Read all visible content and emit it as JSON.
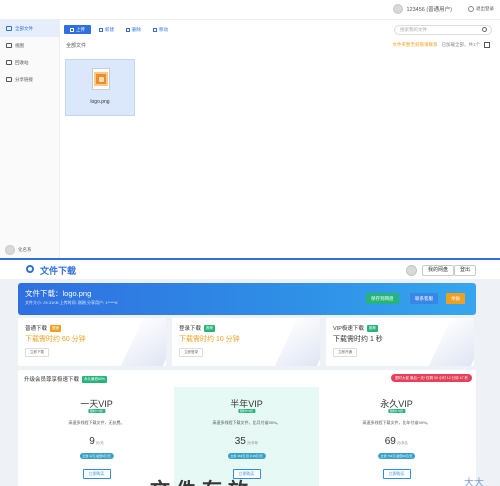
{
  "drive": {
    "user_name": "123456 (普通用户)",
    "logout_label": "退出登录",
    "sidebar": [
      {
        "label": "全部文件",
        "active": true
      },
      {
        "label": "视图",
        "active": false
      },
      {
        "label": "回收站",
        "active": false
      },
      {
        "label": "分享链接",
        "active": false
      }
    ],
    "sidebar_user": "化名系",
    "toolbar": {
      "upload": "上传",
      "new_folder": "新建",
      "delete": "删除",
      "move": "移动"
    },
    "search_placeholder": "搜索我的文件",
    "breadcrumb": "全部文件",
    "notice": "文件夹暂无权限请联系",
    "count_text": "已加载全部，共1个",
    "file": {
      "name": "logo.png"
    }
  },
  "download": {
    "header_title": "文件下载",
    "header_buttons": {
      "my_drive": "我的网盘",
      "logout": "登出"
    },
    "banner": {
      "file_title": "文件下载：logo.png",
      "meta": "文件大小: 25.31KB  上传时间: 刚刚  分享用户: 1*****6",
      "buttons": [
        {
          "label": "保存到网盘",
          "color": "#26b47a"
        },
        {
          "label": "联系客服",
          "color": "#3a86e8"
        },
        {
          "label": "举报",
          "color": "#f0a020"
        }
      ]
    },
    "modes": [
      {
        "title": "普通下载",
        "tag": "慢速",
        "tag_color": "#f0a020",
        "speed": "下载需时约 60 分钟",
        "speed_color": "#f0a020",
        "button": "立即下载"
      },
      {
        "title": "登录下载",
        "tag": "推荐",
        "tag_color": "#26b47a",
        "speed": "下载需时约 10 分钟",
        "speed_color": "#f0a020",
        "button": "立即登录"
      },
      {
        "title": "VIP极速下载",
        "tag": "推荐",
        "tag_color": "#26b47a",
        "speed": "下载需时约 1 秒",
        "speed_color": "#333333",
        "button": "立即开通"
      }
    ],
    "vip": {
      "title": "升级会员尊享极速下载",
      "tag": "永久最低80%",
      "promo": "限时大促 最后一天! 仅剩 00 小时 13 分钟 47 秒",
      "plans": [
        {
          "name": "一天VIP",
          "badge": "限时7.5折",
          "desc": "高速多线程下载文件，无抗费。",
          "price": "9",
          "unit": "元/天",
          "pill": "立省 11元 最低9元/天",
          "buy": "立即购买"
        },
        {
          "name": "半年VIP",
          "badge": "限时5.5折",
          "desc": "高速多线程下载文件，比月付省55%。",
          "price": "35",
          "unit": "元/半年",
          "pill": "立省 163元 仅 0.19元/天",
          "buy": "立即购买"
        },
        {
          "name": "永久VIP",
          "badge": "限时1.5折",
          "desc": "高速多线程下载文件，比年付省90%。",
          "price": "69",
          "unit": "元/永久",
          "pill": "立省 731元 最低69元/天",
          "buy": "立即购买"
        }
      ]
    },
    "watermark": "文件存放",
    "watermark2": "大大"
  }
}
